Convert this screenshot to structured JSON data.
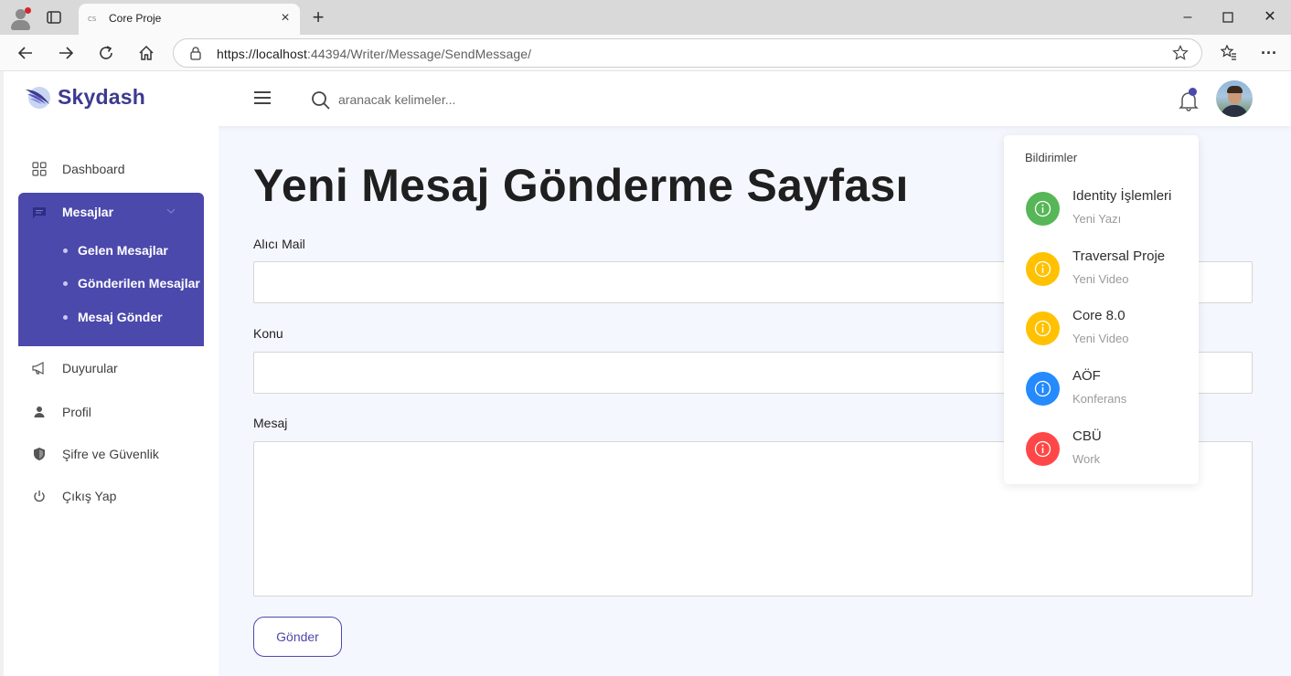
{
  "browser": {
    "tab_title": "Core Proje",
    "tab_favicon_text": "CS",
    "url_host": "https://localhost",
    "url_rest": ":44394/Writer/Message/SendMessage/"
  },
  "header": {
    "brand": "Skydash",
    "search_placeholder": "aranacak kelimeler...",
    "brand_color": "#3d3a8f",
    "accent_color": "#4b49ac"
  },
  "sidebar": {
    "items": [
      {
        "label": "Dashboard",
        "icon": "grid-icon"
      },
      {
        "label": "Mesajlar",
        "icon": "message-icon"
      },
      {
        "label": "Duyurular",
        "icon": "megaphone-icon"
      },
      {
        "label": "Profil",
        "icon": "user-icon"
      },
      {
        "label": "Şifre ve Güvenlik",
        "icon": "shield-icon"
      },
      {
        "label": "Çıkış Yap",
        "icon": "power-icon"
      }
    ],
    "submenu": [
      {
        "label": "Gelen Mesajlar"
      },
      {
        "label": "Gönderilen Mesajlar"
      },
      {
        "label": "Mesaj Gönder"
      }
    ]
  },
  "form": {
    "title": "Yeni Mesaj Gönderme Sayfası",
    "recipient_label": "Alıcı Mail",
    "subject_label": "Konu",
    "message_label": "Mesaj",
    "recipient_value": "",
    "subject_value": "",
    "message_value": "",
    "submit_label": "Gönder"
  },
  "notifications": {
    "title": "Bildirimler",
    "items": [
      {
        "title": "Identity İşlemleri",
        "subtitle": "Yeni Yazı",
        "color": "#57b657"
      },
      {
        "title": "Traversal Proje",
        "subtitle": "Yeni Video",
        "color": "#ffc100"
      },
      {
        "title": "Core 8.0",
        "subtitle": "Yeni Video",
        "color": "#ffc100"
      },
      {
        "title": "AÖF",
        "subtitle": "Konferans",
        "color": "#248afd"
      },
      {
        "title": "CBÜ",
        "subtitle": "Work",
        "color": "#ff4747"
      }
    ]
  }
}
